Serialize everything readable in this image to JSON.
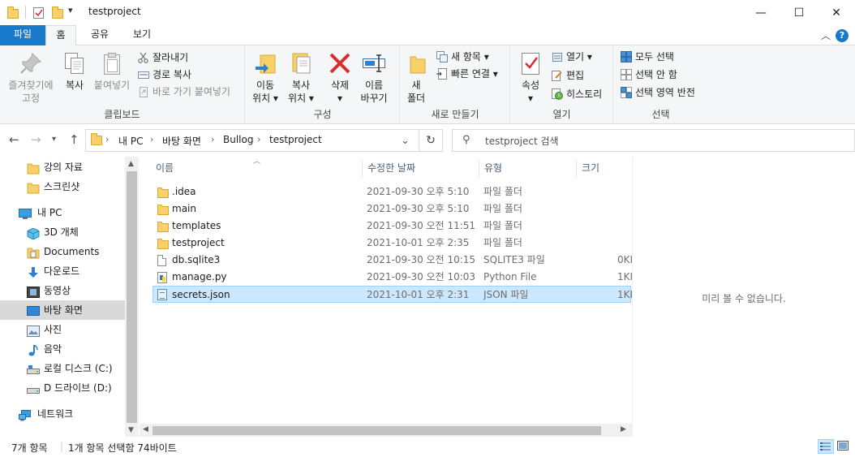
{
  "window": {
    "title": "testproject",
    "minimize": "—",
    "maximize": "☐",
    "close": "✕"
  },
  "ribbon_tabs": [
    {
      "label": "파일"
    },
    {
      "label": "홈"
    },
    {
      "label": "공유"
    },
    {
      "label": "보기"
    }
  ],
  "ribbon": {
    "clipboard": {
      "label": "클립보드",
      "pin": "즐겨찾기에\n고정",
      "pin_l1": "즐겨찾기에",
      "pin_l2": "고정",
      "copy": "복사",
      "paste": "붙여넣기",
      "cut": "잘라내기",
      "copy_path": "경로 복사",
      "paste_shortcut": "바로 가기 붙여넣기"
    },
    "organize": {
      "label": "구성",
      "move_l1": "이동",
      "move_l2": "위치 ▾",
      "copyto_l1": "복사",
      "copyto_l2": "위치 ▾",
      "delete_l1": "삭제",
      "delete_l2": "▾",
      "rename_l1": "이름",
      "rename_l2": "바꾸기"
    },
    "new": {
      "label": "새로 만들기",
      "folder_l1": "새",
      "folder_l2": "폴더",
      "new_item": "새 항목 ▾",
      "easy_access": "빠른 연결 ▾"
    },
    "open": {
      "label": "열기",
      "props_l1": "속성",
      "props_l2": "▾",
      "open": "열기 ▾",
      "edit": "편집",
      "history": "히스토리"
    },
    "select": {
      "label": "선택",
      "all": "모두 선택",
      "none": "선택 안 함",
      "invert": "선택 영역 반전"
    }
  },
  "address": {
    "breadcrumbs": [
      "내 PC",
      "바탕 화면",
      "Bullog",
      "testproject"
    ],
    "search_placeholder": "testproject 검색"
  },
  "nav": {
    "items": [
      {
        "label": "강의 자료"
      },
      {
        "label": "스크린샷"
      },
      {
        "label": "내 PC"
      },
      {
        "label": "3D 개체"
      },
      {
        "label": "Documents"
      },
      {
        "label": "다운로드"
      },
      {
        "label": "동영상"
      },
      {
        "label": "바탕 화면"
      },
      {
        "label": "사진"
      },
      {
        "label": "음악"
      },
      {
        "label": "로컬 디스크 (C:)"
      },
      {
        "label": "D 드라이브 (D:)"
      },
      {
        "label": "네트워크"
      }
    ]
  },
  "columns": {
    "name": "이름",
    "date": "수정한 날짜",
    "type": "유형",
    "size": "크기"
  },
  "files": [
    {
      "name": ".idea",
      "date": "2021-09-30 오후 5:10",
      "type": "파일 폴더",
      "size": ""
    },
    {
      "name": "main",
      "date": "2021-09-30 오후 5:10",
      "type": "파일 폴더",
      "size": ""
    },
    {
      "name": "templates",
      "date": "2021-09-30 오전 11:51",
      "type": "파일 폴더",
      "size": ""
    },
    {
      "name": "testproject",
      "date": "2021-10-01 오후 2:35",
      "type": "파일 폴더",
      "size": ""
    },
    {
      "name": "db.sqlite3",
      "date": "2021-09-30 오전 10:15",
      "type": "SQLITE3 파일",
      "size": "0KI"
    },
    {
      "name": "manage.py",
      "date": "2021-09-30 오전 10:03",
      "type": "Python File",
      "size": "1KI"
    },
    {
      "name": "secrets.json",
      "date": "2021-10-01 오후 2:31",
      "type": "JSON 파일",
      "size": "1KI"
    }
  ],
  "preview": {
    "message": "미리 볼 수 없습니다."
  },
  "status": {
    "count": "7개 항목",
    "selection": "1개 항목 선택함 74바이트"
  },
  "colors": {
    "accent": "#1979ca",
    "selection": "#cce8ff",
    "folder": "#f8d16b"
  }
}
